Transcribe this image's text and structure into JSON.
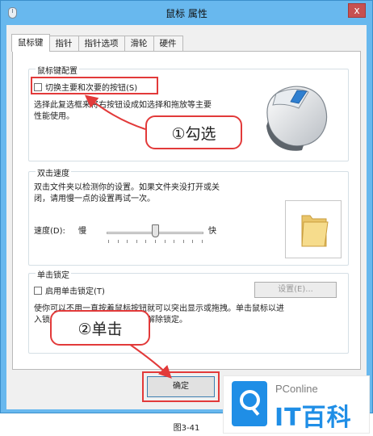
{
  "window": {
    "title": "鼠标 属性",
    "close_glyph": "x"
  },
  "tabs": [
    {
      "label": "鼠标键",
      "active": true
    },
    {
      "label": "指针",
      "active": false
    },
    {
      "label": "指针选项",
      "active": false
    },
    {
      "label": "滑轮",
      "active": false
    },
    {
      "label": "硬件",
      "active": false
    }
  ],
  "button_config": {
    "title": "鼠标键配置",
    "swap_label": "切换主要和次要的按钮(S)",
    "swap_checked": false,
    "desc_line1": "选择此复选框来将右按钮设成如选择和拖放等主要",
    "desc_line2": "性能使用。"
  },
  "double_click": {
    "title": "双击速度",
    "desc_line1": "双击文件夹以检测你的设置。如果文件夹没打开或关",
    "desc_line2": "闭，请用慢一点的设置再试一次。",
    "speed_label": "速度(D):",
    "slow": "慢",
    "fast": "快",
    "speed_level": 0.5
  },
  "click_lock": {
    "title": "单击锁定",
    "enable_label": "启用单击锁定(T)",
    "enable_checked": false,
    "settings_label": "设置(E)...",
    "desc_line1": "使你可以不用一直按着鼠标按钮就可以突出显示或拖拽。单击鼠标以进",
    "desc_line2": "入锁定状态，再次单击鼠标按钮解除锁定。"
  },
  "ok_label": "确定",
  "annotations": {
    "step1": "①勾选",
    "step2": "②单击",
    "color": "#e23a3a"
  },
  "watermark": {
    "top_text": "PConline",
    "main_text": "IT百科",
    "brand_color": "#1f8ee6"
  },
  "caption": "图3-41",
  "icons": [
    "mouse-icon",
    "close-icon",
    "mouse-illustration",
    "folder-icon",
    "search-logo-icon"
  ]
}
